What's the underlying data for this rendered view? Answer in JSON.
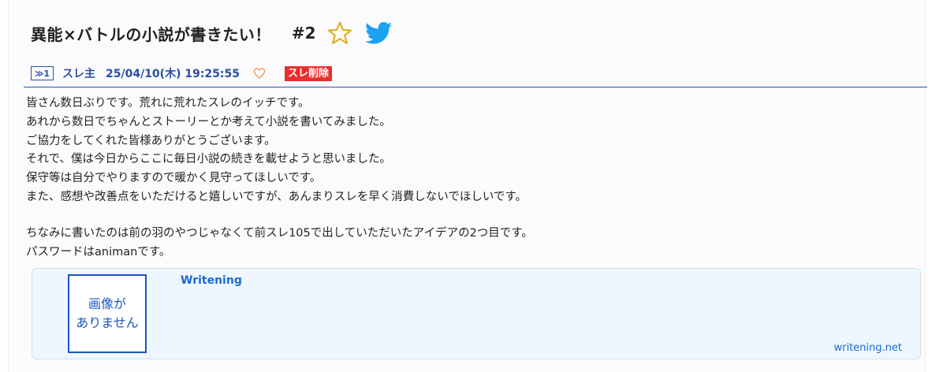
{
  "header": {
    "title": "異能×バトルの小説が書きたい！",
    "thread_number": "#2",
    "favorite_icon": "star-icon",
    "share_icon": "twitter-bird-icon"
  },
  "post": {
    "number_label": "≫1",
    "author": "スレ主",
    "date": "25/04/10(木) 19:25:55",
    "like_icon": "heart-icon",
    "delete_label": "スレ削除",
    "paragraph1": [
      "皆さん数日ぶりです。荒れに荒れたスレのイッチです。",
      "あれから数日でちゃんとストーリーとか考えて小説を書いてみました。",
      "ご協力をしてくれた皆様ありがとうございます。",
      "それで、僕は今日からここに毎日小説の続きを載せようと思いました。",
      "保守等は自分でやりますので暖かく見守ってほしいです。",
      "また、感想や改善点をいただけると嬉しいですが、あんまりスレを早く消費しないでほしいです。"
    ],
    "paragraph2": [
      "ちなみに書いたのは前の羽のやつじゃなくて前スレ105で出していただいたアイデアの2つ目です。",
      "パスワードはanimanです。"
    ]
  },
  "link_card": {
    "no_image_line1": "画像が",
    "no_image_line2": "ありません",
    "title": "Writening",
    "site": "writening.net"
  },
  "colors": {
    "accent_blue": "#2b4fa8",
    "link_blue": "#1a6ad4",
    "delete_red": "#e8302e",
    "star_gold": "#e0b020",
    "twitter_blue": "#1da1f2",
    "heart_orange": "#f0904a"
  }
}
